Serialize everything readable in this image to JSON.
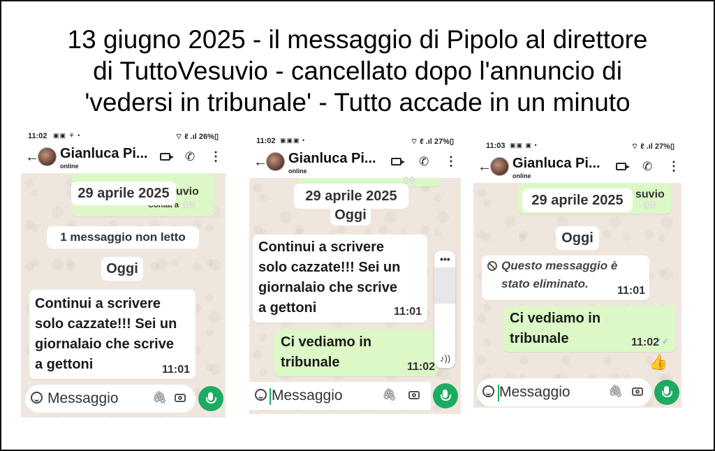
{
  "title": {
    "line1": "13 giugno 2025 - il messaggio di Pipolo al direttore",
    "line2": "di TuttoVesuvio - cancellato dopo l'annuncio di",
    "line3": "'vedersi in tribunale' - Tutto accade in un minuto"
  },
  "screens": [
    {
      "status_time": "11:02",
      "battery": "26%",
      "contact_name": "Gianluca Pi...",
      "contact_status": "online",
      "date_pill": "29 aprile 2025",
      "partial_text": "uvio",
      "partial_contact": "Contat a",
      "partial_time": "09",
      "unread_pill": "1 messaggio non letto",
      "today_pill": "Oggi",
      "messages": [
        {
          "direction": "in",
          "text": "Continui a scrivere\nsolo cazzate!!! Sei un\ngiornalaio che scrive\na gettoni",
          "time": "11:01"
        }
      ],
      "input_placeholder": "Messaggio"
    },
    {
      "status_time": "11:02",
      "battery": "27%",
      "contact_name": "Gianluca Pi...",
      "contact_status": "online",
      "date_pill": "29 aprile 2025",
      "partial_time": "09",
      "today_pill": "Oggi",
      "messages": [
        {
          "direction": "in",
          "text": "Continui a scrivere\nsolo cazzate!!! Sei un\ngiornalaio che scrive\na gettoni",
          "time": "11:01"
        },
        {
          "direction": "out",
          "text": "Ci vediamo in\ntribunale",
          "time": "11:02"
        }
      ],
      "input_placeholder": "Messaggio"
    },
    {
      "status_time": "11:03",
      "battery": "27%",
      "contact_name": "Gianluca Pi...",
      "contact_status": "online",
      "date_pill": "29 aprile 2025",
      "partial_text": "suvio",
      "partial_time": "09",
      "today_pill": "Oggi",
      "messages": [
        {
          "direction": "in",
          "deleted": true,
          "text": "Questo messaggio è\nstato eliminato.",
          "time": "11:01"
        },
        {
          "direction": "out",
          "text": "Ci vediamo in\ntribunale",
          "time": "11:02"
        }
      ],
      "reaction": "👍",
      "input_placeholder": "Messaggio"
    }
  ]
}
